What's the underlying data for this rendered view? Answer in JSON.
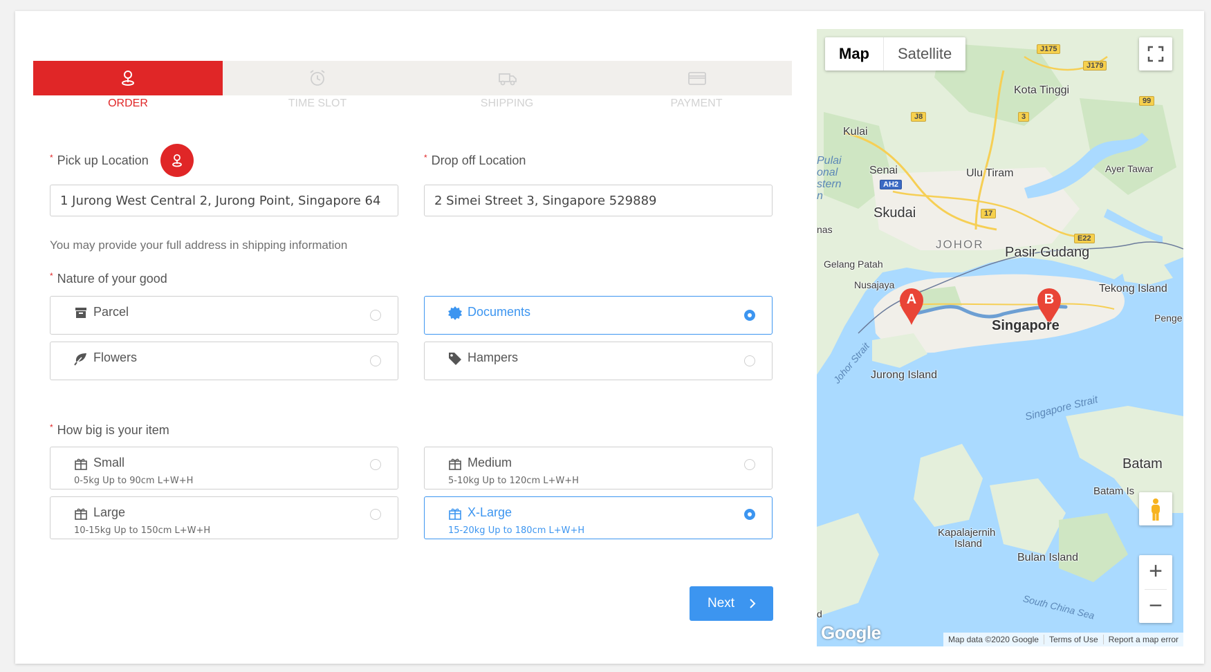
{
  "steps": [
    {
      "label": "ORDER",
      "icon": "location-pin-icon",
      "active": true
    },
    {
      "label": "TIME SLOT",
      "icon": "alarm-clock-icon",
      "active": false
    },
    {
      "label": "SHIPPING",
      "icon": "truck-icon",
      "active": false
    },
    {
      "label": "PAYMENT",
      "icon": "credit-card-icon",
      "active": false
    }
  ],
  "form": {
    "pickup_label": "Pick up Location",
    "pickup_value": "1 Jurong West Central 2, Jurong Point, Singapore 64",
    "dropoff_label": "Drop off Location",
    "dropoff_value": "2 Simei Street 3, Singapore 529889",
    "required_mark": "*",
    "hint": "You may provide your full address in shipping information",
    "nature_label": "Nature of your good",
    "nature_options": [
      {
        "label": "Parcel",
        "icon": "archive-box-icon",
        "selected": false
      },
      {
        "label": "Documents",
        "icon": "certificate-icon",
        "selected": true
      },
      {
        "label": "Flowers",
        "icon": "leaf-icon",
        "selected": false
      },
      {
        "label": "Hampers",
        "icon": "tag-icon",
        "selected": false
      }
    ],
    "size_label": "How big is your item",
    "size_options": [
      {
        "label": "Small",
        "sub": "0-5kg Up to 90cm L+W+H",
        "icon": "gift-box-icon",
        "selected": false
      },
      {
        "label": "Medium",
        "sub": "5-10kg Up to 120cm L+W+H",
        "icon": "gift-box-icon",
        "selected": false
      },
      {
        "label": "Large",
        "sub": "10-15kg Up to 150cm L+W+H",
        "icon": "gift-box-icon",
        "selected": false
      },
      {
        "label": "X-Large",
        "sub": "15-20kg Up to 180cm L+W+H",
        "icon": "gift-box-icon",
        "selected": true
      }
    ],
    "next_label": "Next"
  },
  "map": {
    "type_tabs": [
      "Map",
      "Satellite"
    ],
    "active_type": "Map",
    "places": {
      "kota_tinggi": "Kota Tinggi",
      "kulai": "Kulai",
      "senai": "Senai",
      "ulu_tiram": "Ulu Tiram",
      "ayer_tawar": "Ayer Tawar",
      "skudai": "Skudai",
      "johor": "JOHOR",
      "pasir_gudang": "Pasir Gudang",
      "gelang_patah": "Gelang Patah",
      "nusajaya": "Nusajaya",
      "tekong": "Tekong Island",
      "singapore": "Singapore",
      "penge": "Penge",
      "jurong_island": "Jurong Island",
      "johor_strait": "Johor Strait",
      "singapore_strait": "Singapore Strait",
      "batam": "Batam",
      "batam_is": "Batam Is",
      "kapalajernih": "Kapalajernih",
      "kapalajernih2": "Island",
      "bulan": "Bulan Island",
      "south_china_sea": "South China Sea",
      "pulai": "Pulai",
      "onal": "onal",
      "stern": "stern",
      "n": "n",
      "nas": "nas",
      "d": "d"
    },
    "shields": {
      "j175": "J175",
      "j179": "J179",
      "s99": "99",
      "j8": "J8",
      "s3": "3",
      "ah2": "AH2",
      "s17": "17",
      "e22": "E22"
    },
    "markers": [
      "A",
      "B"
    ],
    "logo": "Google",
    "attribution": [
      "Map data ©2020 Google",
      "Terms of Use",
      "Report a map error"
    ],
    "zoom_in": "+",
    "zoom_out": "−",
    "colors": {
      "water": "#aadaff",
      "land": "#e4efdb",
      "urban": "#f1efe9",
      "route": "#6d9fd3",
      "marker": "#e94436"
    }
  },
  "colors": {
    "primary_red": "#e02627",
    "accent_blue": "#3c95f0"
  }
}
